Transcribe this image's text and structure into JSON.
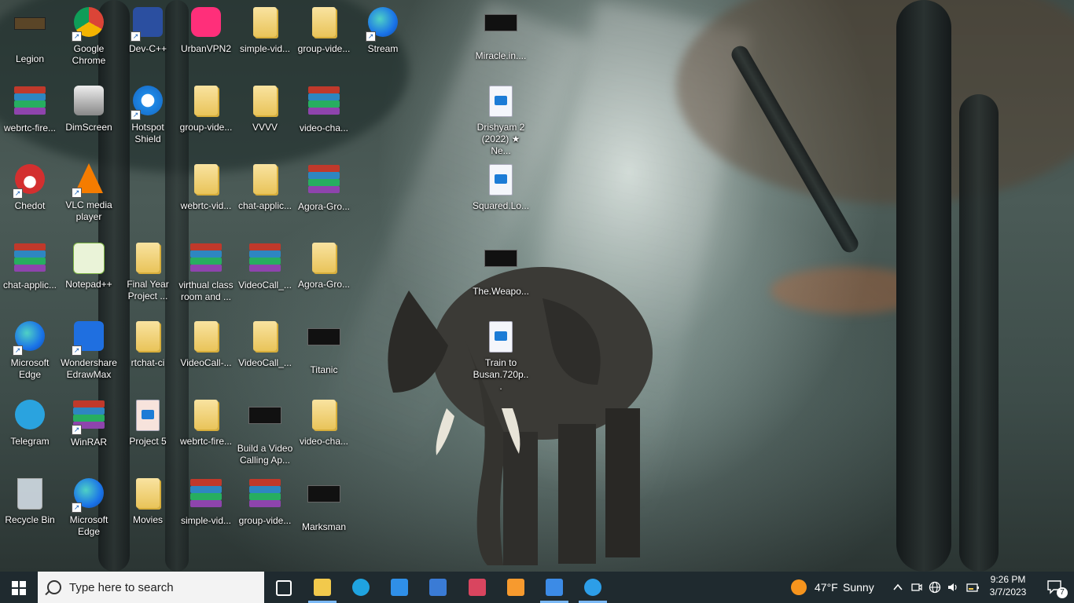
{
  "desktop": {
    "icons": [
      {
        "label": "Legion",
        "icon": "legion-icon",
        "col": 0,
        "row": 0,
        "shortcut": false
      },
      {
        "label": "Google Chrome",
        "icon": "chrome-icon",
        "col": 1,
        "row": 0,
        "shortcut": true
      },
      {
        "label": "Dev-C++",
        "icon": "devcpp-icon",
        "col": 2,
        "row": 0,
        "shortcut": true
      },
      {
        "label": "UrbanVPN2",
        "icon": "urbanvpn-icon",
        "col": 3,
        "row": 0,
        "shortcut": false
      },
      {
        "label": "simple-vid...",
        "icon": "folder-icon",
        "col": 4,
        "row": 0,
        "shortcut": false
      },
      {
        "label": "group-vide...",
        "icon": "folder-icon",
        "col": 5,
        "row": 0,
        "shortcut": false
      },
      {
        "label": "Stream",
        "icon": "edge-icon",
        "col": 6,
        "row": 0,
        "shortcut": true
      },
      {
        "label": "Miracle.in....",
        "icon": "video-thumbnail-icon",
        "col": 8,
        "row": 0,
        "shortcut": false
      },
      {
        "label": "webrtc-fire...",
        "icon": "winrar-archive-icon",
        "col": 0,
        "row": 1,
        "shortcut": false
      },
      {
        "label": "DimScreen",
        "icon": "dimscreen-icon",
        "col": 1,
        "row": 1,
        "shortcut": false
      },
      {
        "label": "Hotspot Shield",
        "icon": "hotspot-shield-icon",
        "col": 2,
        "row": 1,
        "shortcut": true
      },
      {
        "label": "group-vide...",
        "icon": "folder-icon",
        "col": 3,
        "row": 1,
        "shortcut": false
      },
      {
        "label": "VVVV",
        "icon": "folder-icon",
        "col": 4,
        "row": 1,
        "shortcut": false
      },
      {
        "label": "video-cha...",
        "icon": "winrar-archive-icon",
        "col": 5,
        "row": 1,
        "shortcut": false
      },
      {
        "label": "Drishyam 2 (2022) ★ Ne...",
        "icon": "video-file-icon",
        "col": 8,
        "row": 1,
        "shortcut": false
      },
      {
        "label": "Chedot",
        "icon": "chedot-icon",
        "col": 0,
        "row": 2,
        "shortcut": true
      },
      {
        "label": "VLC media player",
        "icon": "vlc-icon",
        "col": 1,
        "row": 2,
        "shortcut": true
      },
      {
        "label": "webrtc-vid...",
        "icon": "folder-icon",
        "col": 3,
        "row": 2,
        "shortcut": false
      },
      {
        "label": "chat-applic...",
        "icon": "folder-icon",
        "col": 4,
        "row": 2,
        "shortcut": false
      },
      {
        "label": "Agora-Gro...",
        "icon": "winrar-archive-icon",
        "col": 5,
        "row": 2,
        "shortcut": false
      },
      {
        "label": "Squared.Lo...",
        "icon": "video-file-icon",
        "col": 8,
        "row": 2,
        "shortcut": false
      },
      {
        "label": "chat-applic...",
        "icon": "winrar-archive-icon",
        "col": 0,
        "row": 3,
        "shortcut": false
      },
      {
        "label": "Notepad++",
        "icon": "notepadpp-icon",
        "col": 1,
        "row": 3,
        "shortcut": false
      },
      {
        "label": "Final Year Project ...",
        "icon": "folder-icon",
        "col": 2,
        "row": 3,
        "shortcut": false
      },
      {
        "label": "virthual class room and ...",
        "icon": "winrar-archive-icon",
        "col": 3,
        "row": 3,
        "shortcut": false
      },
      {
        "label": "VideoCall_...",
        "icon": "winrar-archive-icon",
        "col": 4,
        "row": 3,
        "shortcut": false
      },
      {
        "label": "Agora-Gro...",
        "icon": "folder-icon",
        "col": 5,
        "row": 3,
        "shortcut": false
      },
      {
        "label": "The.Weapo...",
        "icon": "video-thumbnail-icon",
        "col": 8,
        "row": 3,
        "shortcut": false
      },
      {
        "label": "Microsoft Edge",
        "icon": "edge-icon",
        "col": 0,
        "row": 4,
        "shortcut": true
      },
      {
        "label": "Wondershare EdrawMax",
        "icon": "edrawmax-icon",
        "col": 1,
        "row": 4,
        "shortcut": true
      },
      {
        "label": "rtchat-ci",
        "icon": "folder-icon",
        "col": 2,
        "row": 4,
        "shortcut": false
      },
      {
        "label": "VideoCall-...",
        "icon": "folder-icon",
        "col": 3,
        "row": 4,
        "shortcut": false
      },
      {
        "label": "VideoCall_...",
        "icon": "folder-icon",
        "col": 4,
        "row": 4,
        "shortcut": false
      },
      {
        "label": "Titanic",
        "icon": "video-thumbnail-icon",
        "col": 5,
        "row": 4,
        "shortcut": false
      },
      {
        "label": "Train to Busan.720p...",
        "icon": "video-file-icon",
        "col": 8,
        "row": 4,
        "shortcut": false
      },
      {
        "label": "Telegram",
        "icon": "telegram-icon",
        "col": 0,
        "row": 5,
        "shortcut": false
      },
      {
        "label": "WinRAR",
        "icon": "winrar-app-icon",
        "col": 1,
        "row": 5,
        "shortcut": true
      },
      {
        "label": "Project 5",
        "icon": "powerpoint-icon",
        "col": 2,
        "row": 5,
        "shortcut": false
      },
      {
        "label": "webrtc-fire...",
        "icon": "folder-icon",
        "col": 3,
        "row": 5,
        "shortcut": false
      },
      {
        "label": "Build a Video Calling Ap...",
        "icon": "video-thumbnail-icon",
        "col": 4,
        "row": 5,
        "shortcut": false
      },
      {
        "label": "video-cha...",
        "icon": "folder-icon",
        "col": 5,
        "row": 5,
        "shortcut": false
      },
      {
        "label": "Recycle Bin",
        "icon": "recycle-bin-icon",
        "col": 0,
        "row": 6,
        "shortcut": false
      },
      {
        "label": "Microsoft Edge",
        "icon": "edge-icon",
        "col": 1,
        "row": 6,
        "shortcut": true
      },
      {
        "label": "Movies",
        "icon": "folder-icon",
        "col": 2,
        "row": 6,
        "shortcut": false
      },
      {
        "label": "simple-vid...",
        "icon": "winrar-archive-icon",
        "col": 3,
        "row": 6,
        "shortcut": false
      },
      {
        "label": "group-vide...",
        "icon": "winrar-archive-icon",
        "col": 4,
        "row": 6,
        "shortcut": false
      },
      {
        "label": "Marksman",
        "icon": "video-thumbnail-icon",
        "col": 5,
        "row": 6,
        "shortcut": false
      }
    ]
  },
  "taskbar": {
    "search_placeholder": "Type here to search",
    "pinned": [
      {
        "name": "task-view-icon",
        "color": "#ffffff",
        "active": false
      },
      {
        "name": "file-explorer-icon",
        "color": "#f2c94c",
        "active": true
      },
      {
        "name": "edge-icon",
        "color": "#1fa3e0",
        "active": false
      },
      {
        "name": "mail-icon",
        "color": "#2f8fe8",
        "active": false
      },
      {
        "name": "microsoft-store-icon",
        "color": "#3a7bd5",
        "active": false
      },
      {
        "name": "snipping-tool-icon",
        "color": "#d9455f",
        "active": false
      },
      {
        "name": "sublime-text-icon",
        "color": "#f79a2e",
        "active": false
      },
      {
        "name": "media-player-icon",
        "color": "#3c8be6",
        "active": true
      },
      {
        "name": "edge-dev-icon",
        "color": "#2d9ee8",
        "active": true
      }
    ],
    "weather": {
      "temp": "47°F",
      "condition": "Sunny"
    },
    "clock": {
      "time": "9:26 PM",
      "date": "3/7/2023"
    },
    "notifications_count": "7"
  }
}
